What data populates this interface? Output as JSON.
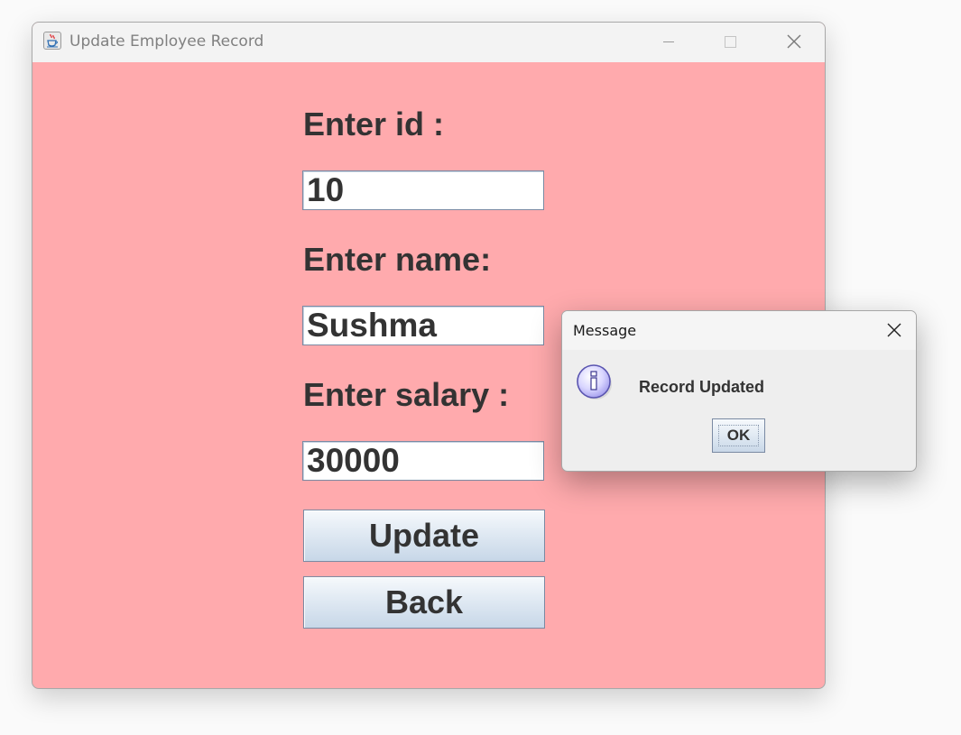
{
  "window": {
    "title": "Update Employee Record",
    "app_icon": "java-coffee-cup-icon",
    "controls": [
      "minimize-icon",
      "maximize-icon",
      "close-icon"
    ],
    "background_color": "#ffaaad"
  },
  "form": {
    "id_label": "Enter id :",
    "id_value": "10",
    "name_label": "Enter name:",
    "name_value": "Sushma",
    "salary_label": "Enter salary :",
    "salary_value": "30000",
    "update_button": "Update",
    "back_button": "Back"
  },
  "dialog": {
    "title": "Message",
    "icon": "information-icon",
    "message": "Record Updated",
    "ok_button": "OK"
  }
}
